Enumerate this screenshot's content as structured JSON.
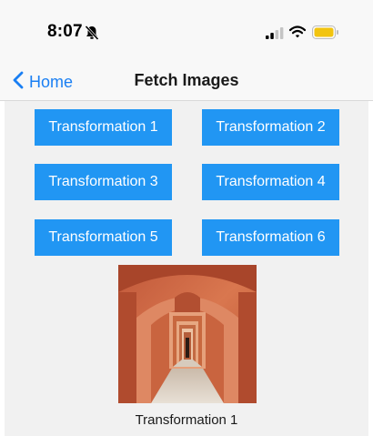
{
  "status_bar": {
    "time": "8:07",
    "icons": [
      "bell-slash-icon",
      "signal-icon",
      "wifi-icon",
      "battery-icon"
    ],
    "battery_color": "#f2c40f"
  },
  "nav": {
    "back_label": "Home",
    "title": "Fetch Images",
    "accent_color": "#1a7ff3"
  },
  "buttons": [
    {
      "label": "Transformation 1"
    },
    {
      "label": "Transformation 2"
    },
    {
      "label": "Transformation 3"
    },
    {
      "label": "Transformation 4"
    },
    {
      "label": "Transformation 5"
    },
    {
      "label": "Transformation 6"
    }
  ],
  "button_color": "#2196f3",
  "image": {
    "caption": "Transformation 1"
  }
}
